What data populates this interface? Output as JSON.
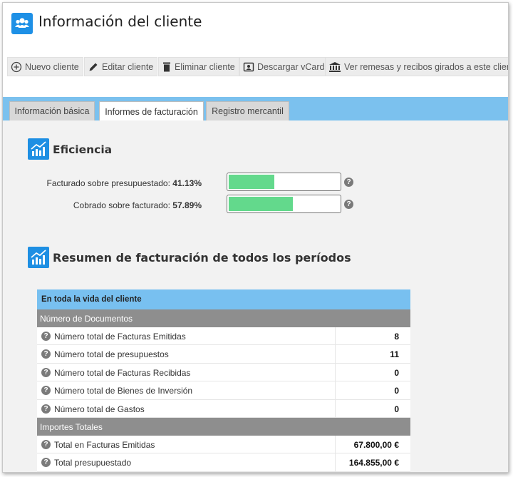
{
  "header": {
    "title": "Información del cliente",
    "icon": "users-icon"
  },
  "toolbar": {
    "new_client": "Nuevo cliente",
    "edit_client": "Editar cliente",
    "delete_client": "Eliminar cliente",
    "download_vcard": "Descargar vCard",
    "view_remittances": "Ver remesas y recibos girados a este cliente"
  },
  "tabs": [
    {
      "label": "Información básica",
      "active": false
    },
    {
      "label": "Informes de facturación",
      "active": true
    },
    {
      "label": "Registro mercantil",
      "active": false
    }
  ],
  "efficiency": {
    "title": "Eficiencia",
    "metrics": [
      {
        "label": "Facturado sobre presupuestado:",
        "value": "41.13%",
        "fraction": 0.4113
      },
      {
        "label": "Cobrado sobre facturado:",
        "value": "57.89%",
        "fraction": 0.5789
      }
    ]
  },
  "summary": {
    "title": "Resumen de facturación de todos los períodos",
    "table_header": "En toda la vida del cliente",
    "groups": [
      {
        "title": "Número de Documentos",
        "rows": [
          {
            "label": "Número total de Facturas Emitidas",
            "value": "8"
          },
          {
            "label": "Número total de presupuestos",
            "value": "11"
          },
          {
            "label": "Número total de Facturas Recibidas",
            "value": "0"
          },
          {
            "label": "Número total de Bienes de Inversión",
            "value": "0"
          },
          {
            "label": "Número total de Gastos",
            "value": "0"
          }
        ]
      },
      {
        "title": "Importes Totales",
        "rows": [
          {
            "label": "Total en Facturas Emitidas",
            "value": "67.800,00 €"
          },
          {
            "label": "Total presupuestado",
            "value": "164.855,00 €"
          }
        ]
      }
    ]
  },
  "colors": {
    "accent": "#1e8fe3",
    "tabbar": "#7bc1ee",
    "progress": "#63d98c",
    "group_header": "#8e8e8e"
  }
}
